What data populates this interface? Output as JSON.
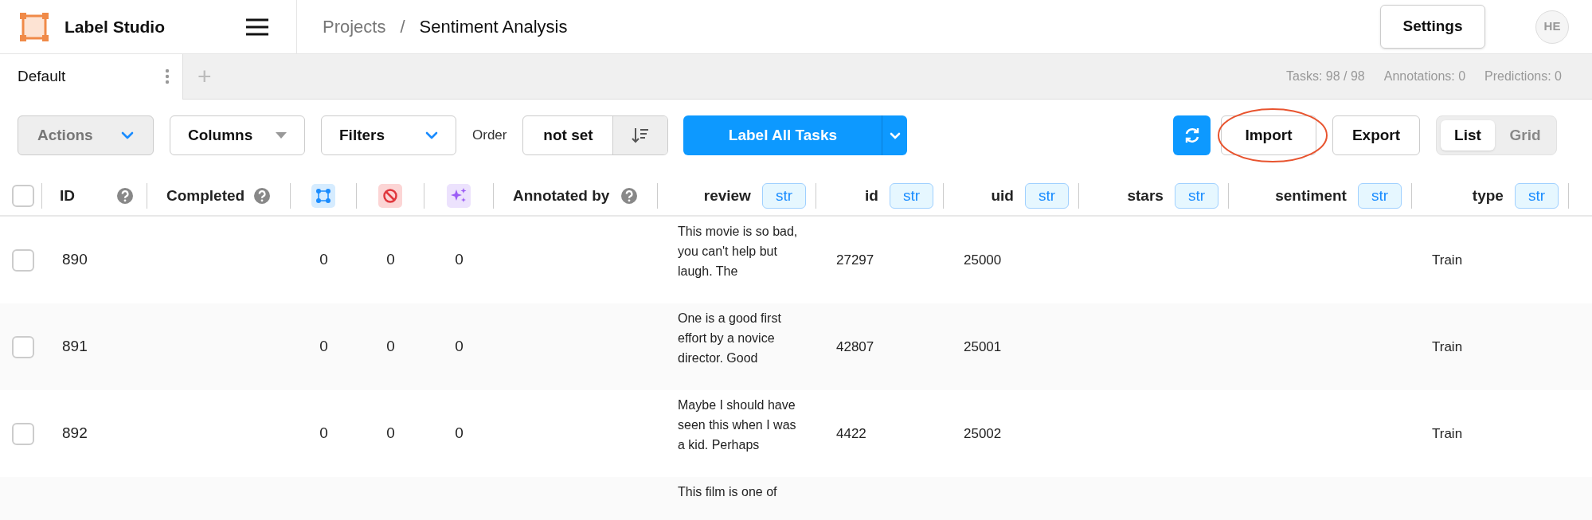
{
  "app": {
    "name": "Label Studio"
  },
  "breadcrumb_separator": "/",
  "breadcrumb": [
    {
      "label": "Projects",
      "current": false
    },
    {
      "label": "Sentiment Analysis",
      "current": true
    }
  ],
  "settings_button": "Settings",
  "avatar": "HE",
  "tabs": [
    {
      "label": "Default",
      "selected": true
    }
  ],
  "add_tab": "+",
  "stats": [
    "Tasks: 98 / 98",
    "Annotations: 0",
    "Predictions: 0"
  ],
  "toolbar": {
    "actions": {
      "label": "Actions",
      "disabled": true
    },
    "columns": "Columns",
    "filters": "Filters",
    "order_label": "Order",
    "order_value": "not set",
    "label_all": "Label All Tasks",
    "import": "Import",
    "import_highlighted": true,
    "export": "Export",
    "views": [
      {
        "label": "List",
        "selected": true
      },
      {
        "label": "Grid",
        "selected": false
      }
    ]
  },
  "table": {
    "select_all": {
      "checked": false
    },
    "columns": [
      {
        "kind": "text",
        "label": "ID",
        "help": true
      },
      {
        "kind": "text",
        "label": "Completed",
        "help": true
      },
      {
        "kind": "annotations"
      },
      {
        "kind": "cancelled"
      },
      {
        "kind": "predictions"
      },
      {
        "kind": "text",
        "label": "Annotated by",
        "help": true
      },
      {
        "kind": "data",
        "label": "review",
        "type": "str"
      },
      {
        "kind": "data",
        "label": "id",
        "type": "str"
      },
      {
        "kind": "data",
        "label": "uid",
        "type": "str"
      },
      {
        "kind": "data",
        "label": "stars",
        "type": "str"
      },
      {
        "kind": "data",
        "label": "sentiment",
        "type": "str"
      },
      {
        "kind": "data",
        "label": "type",
        "type": "str"
      }
    ],
    "rows": [
      {
        "checked": false,
        "id": "890",
        "annotations": "0",
        "cancelled": "0",
        "predictions": "0",
        "review": "This movie is so bad, you can't help but laugh. The",
        "data_id": "27297",
        "uid": "25000",
        "type": "Train"
      },
      {
        "checked": false,
        "id": "891",
        "annotations": "0",
        "cancelled": "0",
        "predictions": "0",
        "review": "One is a good first effort by a novice director. Good",
        "data_id": "42807",
        "uid": "25001",
        "type": "Train"
      },
      {
        "checked": false,
        "id": "892",
        "annotations": "0",
        "cancelled": "0",
        "predictions": "0",
        "review": "Maybe I should have seen this when I was a kid. Perhaps",
        "data_id": "4422",
        "uid": "25002",
        "type": "Train"
      },
      {
        "review": "This film is one of"
      }
    ]
  }
}
